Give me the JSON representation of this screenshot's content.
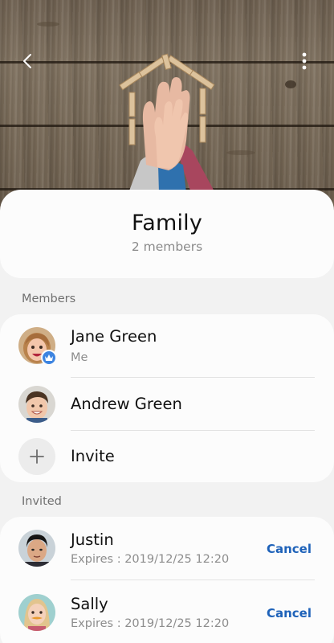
{
  "header": {
    "back_icon": "arrow-left-icon",
    "more_icon": "more-vertical-icon"
  },
  "group": {
    "name": "Family",
    "member_count": "2 members"
  },
  "members_section": {
    "label": "Members",
    "items": [
      {
        "name": "Jane Green",
        "subtitle": "Me",
        "badge_icon": "crown-icon"
      },
      {
        "name": "Andrew Green"
      }
    ],
    "invite_label": "Invite",
    "invite_icon": "plus-icon"
  },
  "invited_section": {
    "label": "Invited",
    "items": [
      {
        "name": "Justin",
        "expires": "Expires : 2019/12/25 12:20",
        "action": "Cancel"
      },
      {
        "name": "Sally",
        "expires": "Expires : 2019/12/25 12:20",
        "action": "Cancel"
      }
    ]
  },
  "colors": {
    "accent": "#1e62b9",
    "badge": "#3d84e0",
    "background": "#f2f2f2",
    "card": "#fcfcfc"
  }
}
